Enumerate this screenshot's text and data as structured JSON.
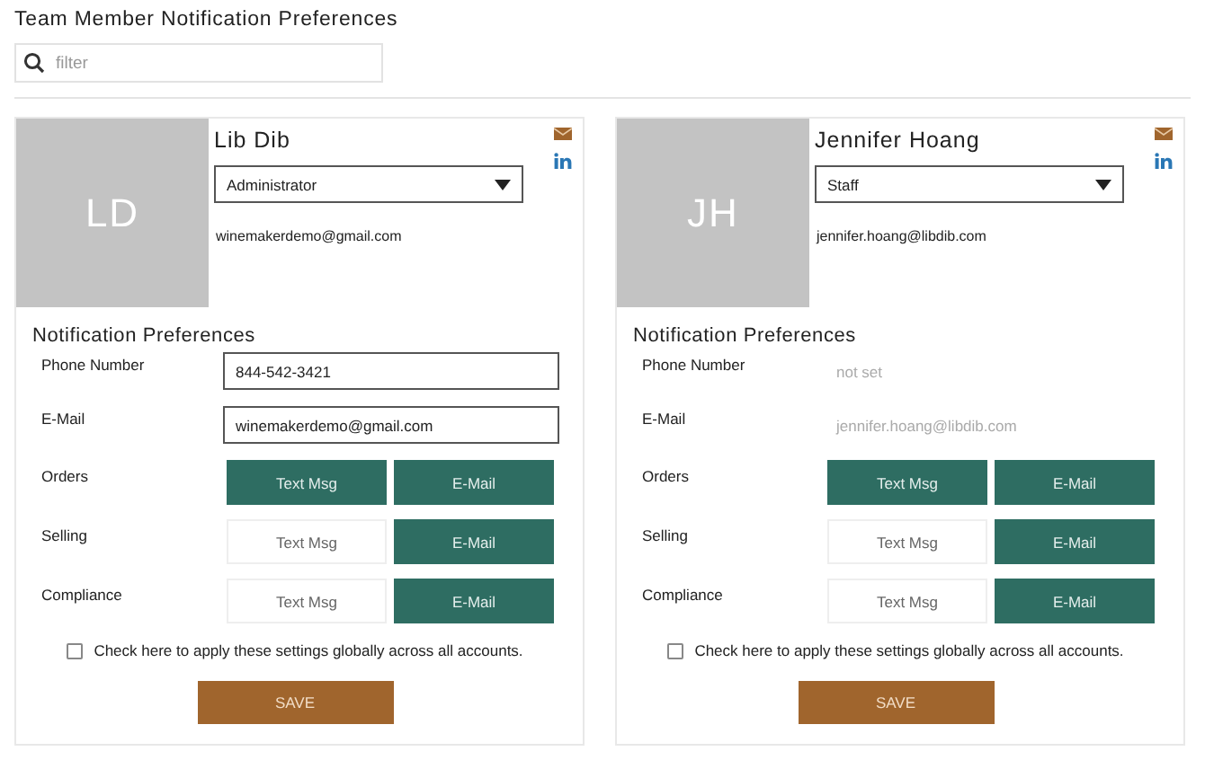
{
  "title": "Team Member Notification Preferences",
  "search": {
    "placeholder": "filter"
  },
  "members": [
    {
      "initials": "LD",
      "name": "Lib Dib",
      "role": "Administrator",
      "email": "winemakerdemo@gmail.com",
      "section_title": "Notification Preferences",
      "contact": [
        {
          "label": "Phone Number",
          "value": "844-542-3421",
          "editable": true
        },
        {
          "label": "E-Mail",
          "value": "winemakerdemo@gmail.com",
          "editable": true
        }
      ],
      "preferences": [
        {
          "label": "Orders",
          "options": [
            {
              "label": "Text Msg",
              "selected": true
            },
            {
              "label": "E-Mail",
              "selected": true
            }
          ]
        },
        {
          "label": "Selling",
          "options": [
            {
              "label": "Text Msg",
              "selected": false
            },
            {
              "label": "E-Mail",
              "selected": true
            }
          ]
        },
        {
          "label": "Compliance",
          "options": [
            {
              "label": "Text Msg",
              "selected": false
            },
            {
              "label": "E-Mail",
              "selected": true
            }
          ]
        }
      ],
      "global": {
        "label": "Check here to apply these settings globally across all accounts.",
        "checked": false
      },
      "save": "SAVE"
    },
    {
      "initials": "JH",
      "name": "Jennifer Hoang",
      "role": "Staff",
      "email": "jennifer.hoang@libdib.com",
      "section_title": "Notification Preferences",
      "contact": [
        {
          "label": "Phone Number",
          "value": "not set",
          "editable": false
        },
        {
          "label": "E-Mail",
          "value": "jennifer.hoang@libdib.com",
          "editable": false
        }
      ],
      "preferences": [
        {
          "label": "Orders",
          "options": [
            {
              "label": "Text Msg",
              "selected": true
            },
            {
              "label": "E-Mail",
              "selected": true
            }
          ]
        },
        {
          "label": "Selling",
          "options": [
            {
              "label": "Text Msg",
              "selected": false
            },
            {
              "label": "E-Mail",
              "selected": true
            }
          ]
        },
        {
          "label": "Compliance",
          "options": [
            {
              "label": "Text Msg",
              "selected": false
            },
            {
              "label": "E-Mail",
              "selected": true
            }
          ]
        }
      ],
      "global": {
        "label": "Check here to apply these settings globally across all accounts.",
        "checked": false
      },
      "save": "SAVE"
    }
  ]
}
